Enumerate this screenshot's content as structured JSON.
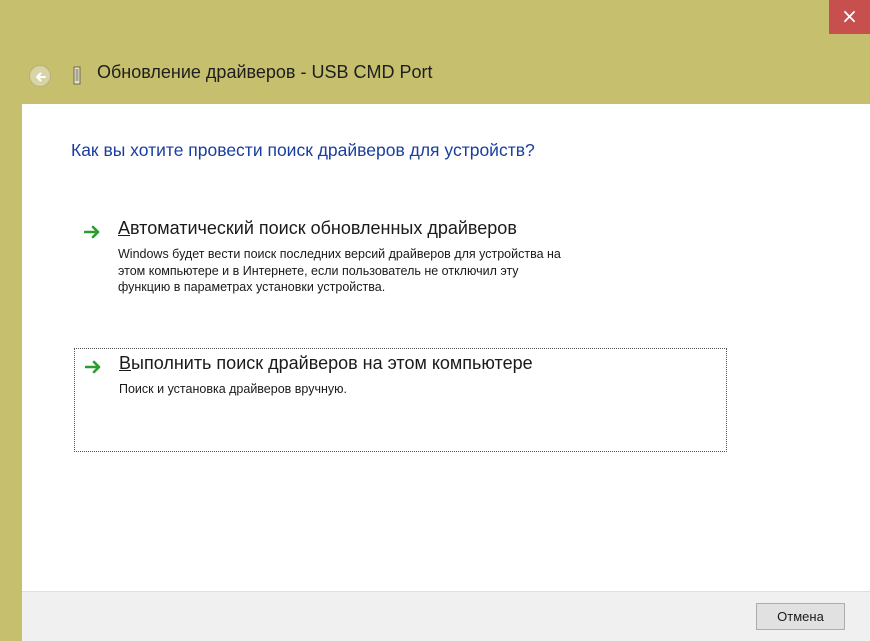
{
  "window": {
    "close_label": "×",
    "title": "Обновление драйверов - USB CMD Port"
  },
  "content": {
    "question": "Как вы хотите провести поиск драйверов для устройств?",
    "options": [
      {
        "title_first": "А",
        "title_rest": "втоматический поиск обновленных драйверов",
        "description": "Windows будет вести поиск последних версий драйверов для устройства на\nэтом компьютере и в Интернете, если пользователь не отключил эту\nфункцию в параметрах установки устройства."
      },
      {
        "title_first": "В",
        "title_rest": "ыполнить поиск драйверов на этом компьютере",
        "description": "Поиск и установка драйверов вручную."
      }
    ]
  },
  "footer": {
    "cancel_label": "Отмена"
  },
  "colors": {
    "frame": "#c6bf6d",
    "close": "#c7504f",
    "heading": "#1a3e9f",
    "arrow": "#2a9d2f"
  },
  "icons": [
    "back-arrow-icon",
    "usb-device-icon",
    "green-arrow-icon"
  ]
}
